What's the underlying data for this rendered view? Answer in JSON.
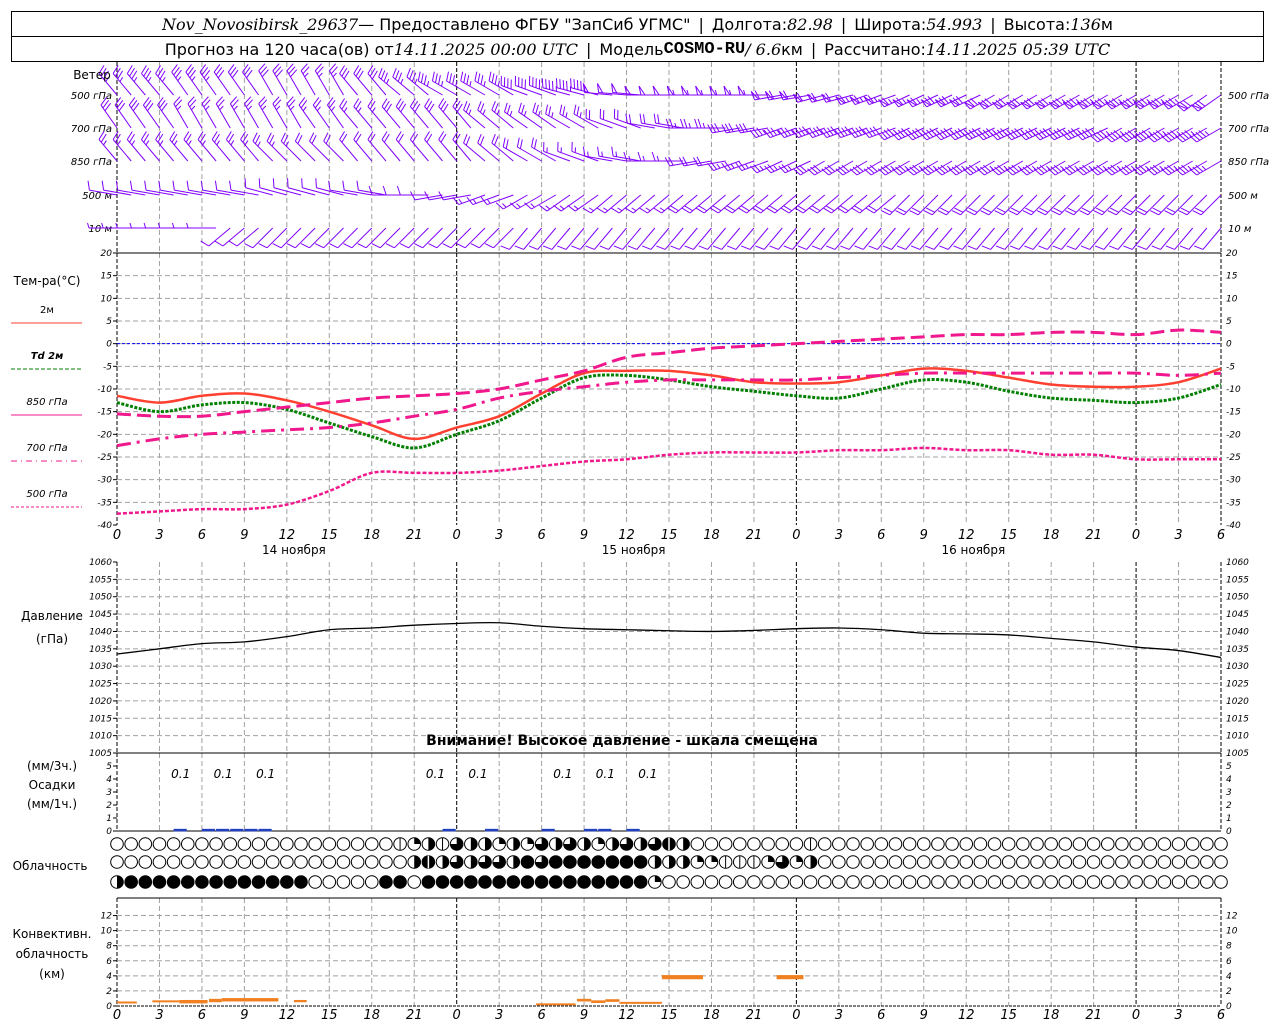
{
  "header": {
    "station": "Nov_Novosibirsk_29637",
    "provided": "— Предоставлено ФГБУ \"ЗапСиб УГМС\"",
    "lon_label": "Долгота:",
    "lon": "82.98",
    "lat_label": "Широта:",
    "lat": "54.993",
    "alt_label": "Высота:",
    "alt": "136",
    "alt_unit": "м",
    "forecast_label": "Прогноз на 120 часа(ов) от",
    "forecast_start": "14.11.2025 00:00 UTC",
    "model_label": "Модель",
    "model": "COSMO-RU",
    "resolution": "/ 6.6",
    "res_unit": "км",
    "computed_label": "Рассчитано:",
    "computed": "14.11.2025 05:39 UTC"
  },
  "labels": {
    "wind": "Ветер",
    "levels": [
      "500 гПа",
      "700 гПа",
      "850 гПа",
      "500 м",
      "10 м"
    ],
    "temp_title": "Тем-ра(°C)",
    "legend": [
      "2м",
      "Td  2м",
      "850 гПа",
      "700 гПа",
      "500 гПа"
    ],
    "pressure": [
      "Давление",
      "(гПа)"
    ],
    "precip": [
      "(мм/3ч.)",
      "Осадки",
      "(мм/1ч.)"
    ],
    "cloud": "Облачность",
    "convective": [
      "Конвективн.",
      "облачность",
      "(км)"
    ],
    "warning": "Внимание! Высокое давление - шкала смещена"
  },
  "colors": {
    "wind": "#8000ff",
    "t2m": "#ff4030",
    "td2m": "#008000",
    "upper": "#f0188c",
    "zero": "#0000ff",
    "grid": "#a0a0a0",
    "precip": "#2040c0",
    "convective": "#f08020"
  },
  "x_axis": {
    "hours": [
      "0",
      "3",
      "6",
      "9",
      "12",
      "15",
      "18",
      "21",
      "0",
      "3",
      "6",
      "9",
      "12",
      "15",
      "18",
      "21",
      "0",
      "3",
      "6",
      "9",
      "12",
      "15",
      "18",
      "21",
      "0",
      "3",
      "6"
    ],
    "days": [
      {
        "label": "14 ноября",
        "hour": 12.5
      },
      {
        "label": "15 ноября",
        "hour": 36.5
      },
      {
        "label": "16 ноября",
        "hour": 60.5
      }
    ],
    "range_hours": [
      0,
      78
    ]
  },
  "chart_data": [
    {
      "type": "line",
      "name": "temperature",
      "ylim": [
        -40,
        20
      ],
      "yticks": [
        "20",
        "15",
        "10",
        "5",
        "0",
        "-5",
        "-10",
        "-15",
        "-20",
        "-25",
        "-30",
        "-35",
        "-40"
      ],
      "x": [
        0,
        3,
        6,
        9,
        12,
        15,
        18,
        21,
        24,
        27,
        30,
        33,
        36,
        39,
        42,
        45,
        48,
        51,
        54,
        57,
        60,
        63,
        66,
        69,
        72,
        75,
        78
      ],
      "series": [
        {
          "name": "2м",
          "values": [
            -11.5,
            -13,
            -11.5,
            -11,
            -12.5,
            -15,
            -18,
            -21,
            -18.5,
            -16,
            -11,
            -6.5,
            -6,
            -6,
            -7,
            -8.5,
            -8.8,
            -8.5,
            -7,
            -5.5,
            -6,
            -7.5,
            -9,
            -9.5,
            -9.5,
            -8.5,
            -5.5
          ]
        },
        {
          "name": "Td  2м",
          "values": [
            -13,
            -15,
            -13.5,
            -13,
            -14.5,
            -17.5,
            -20.5,
            -23,
            -20,
            -17,
            -12,
            -7.5,
            -7,
            -8,
            -9.5,
            -10.5,
            -11.5,
            -12,
            -10,
            -8,
            -8.5,
            -10.5,
            -12,
            -12.5,
            -13,
            -12,
            -9
          ]
        },
        {
          "name": "850 гПа",
          "values": [
            -15.5,
            -16,
            -16,
            -15,
            -14,
            -13,
            -12,
            -11.5,
            -11,
            -10,
            -8,
            -6,
            -3,
            -2,
            -1,
            -0.5,
            0,
            0.5,
            1,
            1.5,
            2,
            2,
            2.5,
            2.5,
            2,
            3,
            2.5
          ]
        },
        {
          "name": "700 гПа",
          "values": [
            -22.5,
            -21,
            -20,
            -19.5,
            -19,
            -18.5,
            -17.5,
            -16,
            -14.5,
            -12,
            -10.5,
            -9.5,
            -8.5,
            -8,
            -8,
            -8,
            -8,
            -7.5,
            -7,
            -6.5,
            -6.5,
            -6.5,
            -6.5,
            -6.5,
            -6.5,
            -7,
            -6.5
          ]
        },
        {
          "name": "500 гПа",
          "values": [
            -37.5,
            -37,
            -36.5,
            -36.5,
            -35.5,
            -32.5,
            -28.5,
            -28.5,
            -28.5,
            -28,
            -27,
            -26,
            -25.5,
            -24.5,
            -24,
            -24,
            -24,
            -23.5,
            -23.5,
            -23,
            -23.5,
            -23.5,
            -24.5,
            -24.5,
            -25.5,
            -25.5,
            -25.5
          ]
        }
      ]
    },
    {
      "type": "line",
      "name": "pressure",
      "ylim": [
        1005,
        1060
      ],
      "yticks": [
        "1060",
        "1055",
        "1050",
        "1045",
        "1040",
        "1035",
        "1030",
        "1025",
        "1020",
        "1015",
        "1010",
        "1005"
      ],
      "x": [
        0,
        3,
        6,
        9,
        12,
        15,
        18,
        21,
        24,
        27,
        30,
        33,
        36,
        39,
        42,
        45,
        48,
        51,
        54,
        57,
        60,
        63,
        66,
        69,
        72,
        75,
        78
      ],
      "values": [
        1033.5,
        1035,
        1036.5,
        1037,
        1038.5,
        1040.5,
        1041,
        1041.8,
        1042.3,
        1042.5,
        1041.5,
        1040.8,
        1040.5,
        1040.2,
        1040,
        1040.3,
        1040.8,
        1041,
        1040.5,
        1039.5,
        1039.3,
        1039,
        1038,
        1037,
        1035.5,
        1034.5,
        1032.5
      ]
    },
    {
      "type": "bar",
      "name": "precipitation",
      "ylim": [
        0,
        5
      ],
      "yticks": [
        "5",
        "4",
        "3",
        "2",
        "1",
        "0"
      ],
      "hourly_hours": [
        4,
        6,
        7,
        8,
        9,
        10,
        23,
        26,
        30,
        33,
        34,
        36
      ],
      "hourly_value": 0.05,
      "totals_3h": [
        {
          "hour": 4.5,
          "label": "0.1"
        },
        {
          "hour": 7.5,
          "label": "0.1"
        },
        {
          "hour": 10.5,
          "label": "0.1"
        },
        {
          "hour": 22.5,
          "label": "0.1"
        },
        {
          "hour": 25.5,
          "label": "0.1"
        },
        {
          "hour": 31.5,
          "label": "0.1"
        },
        {
          "hour": 34.5,
          "label": "0.1"
        },
        {
          "hour": 37.5,
          "label": "0.1"
        }
      ]
    },
    {
      "type": "table",
      "name": "cloudiness_octas",
      "rows": [
        [
          0,
          0,
          0,
          0,
          0,
          0,
          0,
          0,
          0,
          0,
          0,
          0,
          0,
          0,
          0,
          0,
          0,
          0,
          0,
          0,
          1,
          2,
          4,
          1,
          6,
          4,
          4,
          2,
          4,
          2,
          6,
          4,
          6,
          4,
          2,
          4,
          6,
          4,
          6,
          7,
          4,
          0,
          0,
          0,
          0,
          0,
          0,
          0,
          0,
          1,
          0,
          0,
          0,
          0,
          0,
          0,
          0,
          0,
          0,
          0,
          0,
          0,
          0,
          0,
          0,
          0,
          0,
          0,
          0,
          0,
          0,
          0,
          0,
          0,
          0,
          0,
          0,
          0,
          0
        ],
        [
          0,
          0,
          0,
          0,
          0,
          0,
          0,
          0,
          0,
          0,
          0,
          0,
          0,
          0,
          0,
          0,
          0,
          0,
          0,
          0,
          0,
          4,
          7,
          4,
          6,
          4,
          6,
          6,
          4,
          8,
          6,
          8,
          8,
          8,
          8,
          8,
          8,
          8,
          4,
          4,
          4,
          2,
          2,
          1,
          1,
          1,
          2,
          6,
          2,
          4,
          0,
          0,
          0,
          0,
          0,
          0,
          0,
          0,
          0,
          0,
          0,
          0,
          0,
          0,
          0,
          0,
          0,
          0,
          0,
          0,
          0,
          0,
          0,
          0,
          0,
          0,
          0,
          0,
          0
        ],
        [
          4,
          8,
          8,
          8,
          8,
          8,
          8,
          8,
          8,
          8,
          8,
          8,
          8,
          8,
          0,
          0,
          0,
          0,
          0,
          8,
          8,
          0,
          8,
          8,
          8,
          8,
          8,
          8,
          8,
          8,
          8,
          8,
          8,
          8,
          8,
          8,
          8,
          8,
          2,
          0,
          0,
          0,
          0,
          0,
          0,
          0,
          0,
          0,
          0,
          0,
          0,
          0,
          0,
          0,
          0,
          0,
          0,
          0,
          0,
          0,
          0,
          0,
          0,
          0,
          0,
          0,
          0,
          0,
          0,
          0,
          0,
          0,
          0,
          0,
          0,
          0,
          0,
          0,
          0
        ]
      ]
    },
    {
      "type": "bar",
      "name": "convective_cloud_km",
      "ylim": [
        0,
        13
      ],
      "yticks": [
        "12",
        "10",
        "8",
        "6",
        "4",
        "2",
        "0"
      ],
      "bars": [
        [
          0,
          1.4,
          0.45,
          0.6
        ],
        [
          2.5,
          4.4,
          0.5,
          0.75
        ],
        [
          4.4,
          6.4,
          0.35,
          0.8
        ],
        [
          6.5,
          7.4,
          0.5,
          0.95
        ],
        [
          7.4,
          11.4,
          0.6,
          1.05
        ],
        [
          12.5,
          13.4,
          0.5,
          0.8
        ],
        [
          29.6,
          32.4,
          0.2,
          0.35
        ],
        [
          32.5,
          33.5,
          0.6,
          0.95
        ],
        [
          33.5,
          34.5,
          0.4,
          0.75
        ],
        [
          34.5,
          35.5,
          0.55,
          0.9
        ],
        [
          35.5,
          38.5,
          0.4,
          0.55
        ],
        [
          38.5,
          41.4,
          3.55,
          4.1
        ],
        [
          46.6,
          48.5,
          3.55,
          4.1
        ]
      ]
    },
    {
      "type": "wind_barbs",
      "name": "wind",
      "x": [
        0,
        3,
        6,
        9,
        12,
        15,
        18,
        21,
        24,
        27,
        30,
        33,
        36,
        39,
        42,
        45,
        48,
        51,
        54,
        57,
        60,
        63,
        66,
        69,
        72,
        75,
        78
      ],
      "levels": [
        {
          "dir": [
            320,
            320,
            325,
            325,
            330,
            330,
            320,
            310,
            300,
            300,
            290,
            285,
            275,
            270,
            270,
            270,
            260,
            255,
            250,
            245,
            245,
            240,
            240,
            240,
            240,
            240,
            235
          ],
          "spd": [
            35,
            35,
            35,
            30,
            30,
            25,
            30,
            35,
            35,
            35,
            40,
            45,
            50,
            50,
            55,
            55,
            60,
            60,
            65,
            65,
            70,
            70,
            70,
            75,
            75,
            75,
            70
          ]
        },
        {
          "dir": [
            325,
            325,
            330,
            330,
            330,
            325,
            320,
            320,
            320,
            310,
            305,
            300,
            290,
            280,
            270,
            260,
            250,
            250,
            250,
            245,
            245,
            245,
            245,
            245,
            240,
            240,
            240
          ],
          "spd": [
            30,
            30,
            25,
            25,
            25,
            25,
            25,
            30,
            30,
            25,
            25,
            25,
            20,
            20,
            25,
            30,
            35,
            40,
            40,
            45,
            45,
            45,
            45,
            45,
            45,
            45,
            45
          ]
        },
        {
          "dir": [
            320,
            320,
            320,
            320,
            315,
            315,
            320,
            320,
            320,
            310,
            300,
            290,
            280,
            270,
            260,
            250,
            245,
            240,
            240,
            240,
            240,
            240,
            240,
            240,
            240,
            240,
            240
          ],
          "spd": [
            25,
            25,
            25,
            25,
            25,
            20,
            20,
            20,
            20,
            20,
            20,
            15,
            15,
            15,
            20,
            25,
            25,
            30,
            30,
            35,
            35,
            35,
            35,
            35,
            35,
            35,
            35
          ]
        },
        {
          "dir": [
            280,
            280,
            280,
            280,
            285,
            285,
            280,
            270,
            260,
            250,
            240,
            235,
            230,
            230,
            230,
            230,
            230,
            230,
            230,
            225,
            225,
            225,
            225,
            225,
            225,
            225,
            225
          ],
          "spd": [
            10,
            10,
            10,
            10,
            10,
            10,
            10,
            10,
            10,
            15,
            15,
            15,
            15,
            15,
            20,
            20,
            20,
            20,
            20,
            20,
            20,
            20,
            20,
            20,
            20,
            20,
            20
          ]
        },
        {
          "dir": [
            270,
            270,
            270,
            230,
            225,
            225,
            225,
            225,
            225,
            225,
            220,
            220,
            220,
            220,
            220,
            220,
            220,
            220,
            220,
            220,
            220,
            220,
            220,
            220,
            220,
            220,
            220
          ],
          "spd": [
            5,
            5,
            5,
            10,
            10,
            10,
            10,
            10,
            10,
            10,
            10,
            10,
            10,
            10,
            10,
            10,
            10,
            10,
            10,
            10,
            10,
            10,
            10,
            10,
            10,
            10,
            10
          ]
        }
      ]
    }
  ]
}
